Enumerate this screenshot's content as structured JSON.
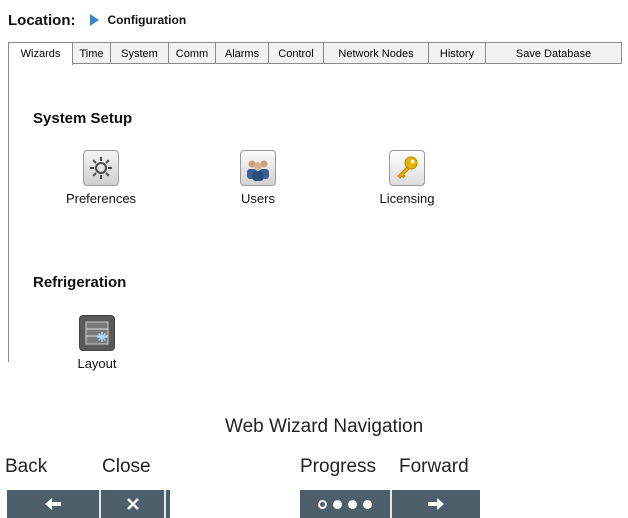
{
  "location": {
    "label": "Location:",
    "value": "Configuration"
  },
  "tabs": [
    {
      "label": "Wizards"
    },
    {
      "label": "Time"
    },
    {
      "label": "System"
    },
    {
      "label": "Comm"
    },
    {
      "label": "Alarms"
    },
    {
      "label": "Control"
    },
    {
      "label": "Network Nodes"
    },
    {
      "label": "History"
    },
    {
      "label": "Save Database"
    }
  ],
  "active_tab": "Wizards",
  "sections": {
    "system_setup": {
      "title": "System Setup",
      "items": [
        {
          "label": "Preferences",
          "icon": "gear-icon"
        },
        {
          "label": "Users",
          "icon": "users-icon"
        },
        {
          "label": "Licensing",
          "icon": "key-icon"
        }
      ]
    },
    "refrigeration": {
      "title": "Refrigeration",
      "items": [
        {
          "label": "Layout",
          "icon": "layout-icon"
        }
      ]
    }
  },
  "legend": {
    "title": "Web Wizard Navigation",
    "back": "Back",
    "close": "Close",
    "progress": "Progress",
    "forward": "Forward"
  },
  "colors": {
    "nav_bar": "#4c5f6b",
    "arrow_accent": "#3d86c8"
  }
}
